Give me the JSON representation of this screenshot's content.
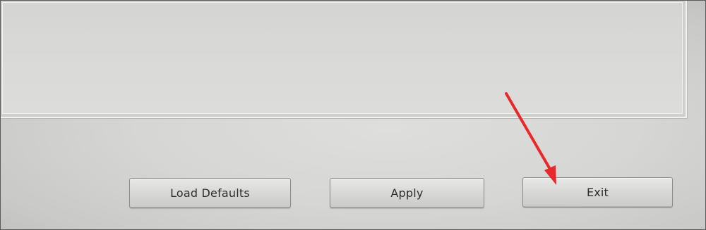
{
  "buttons": {
    "load_defaults": "Load Defaults",
    "apply": "Apply",
    "exit": "Exit"
  },
  "annotation": {
    "arrow_icon": "red-arrow-icon",
    "color": "#e8292b"
  },
  "colors": {
    "background": "#d6d6d4",
    "button_text": "#2c2c2c"
  }
}
